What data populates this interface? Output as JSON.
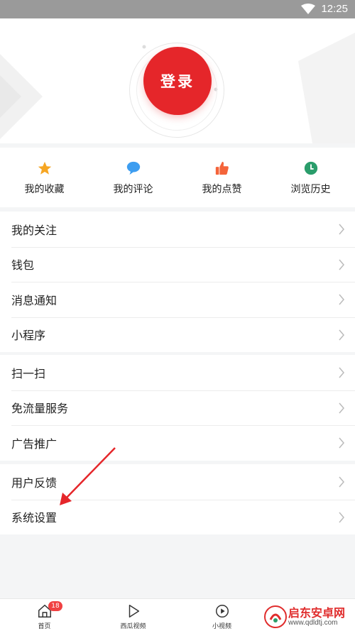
{
  "status_bar": {
    "time": "12:25"
  },
  "header": {
    "login_label": "登录"
  },
  "quick_actions": [
    {
      "label": "我的收藏",
      "icon": "star-icon",
      "color": "#f6a623"
    },
    {
      "label": "我的评论",
      "icon": "comment-icon",
      "color": "#3d9df0"
    },
    {
      "label": "我的点赞",
      "icon": "thumb-up-icon",
      "color": "#f4643a"
    },
    {
      "label": "浏览历史",
      "icon": "clock-icon",
      "color": "#2a9d6b"
    }
  ],
  "menu_groups": [
    [
      "我的关注",
      "钱包",
      "消息通知",
      "小程序"
    ],
    [
      "扫一扫",
      "免流量服务",
      "广告推广"
    ],
    [
      "用户反馈",
      "系统设置"
    ]
  ],
  "tabbar": {
    "items": [
      {
        "label": "首页",
        "icon": "home-icon",
        "badge": "18"
      },
      {
        "label": "西瓜视频",
        "icon": "play-icon"
      },
      {
        "label": "小视频",
        "icon": "short-video-icon"
      }
    ]
  },
  "watermark": {
    "title": "启东安卓网",
    "url": "www.qdldtj.com"
  },
  "colors": {
    "accent": "#e5262a",
    "badge": "#f04142",
    "annotation_arrow": "#e5262a"
  }
}
